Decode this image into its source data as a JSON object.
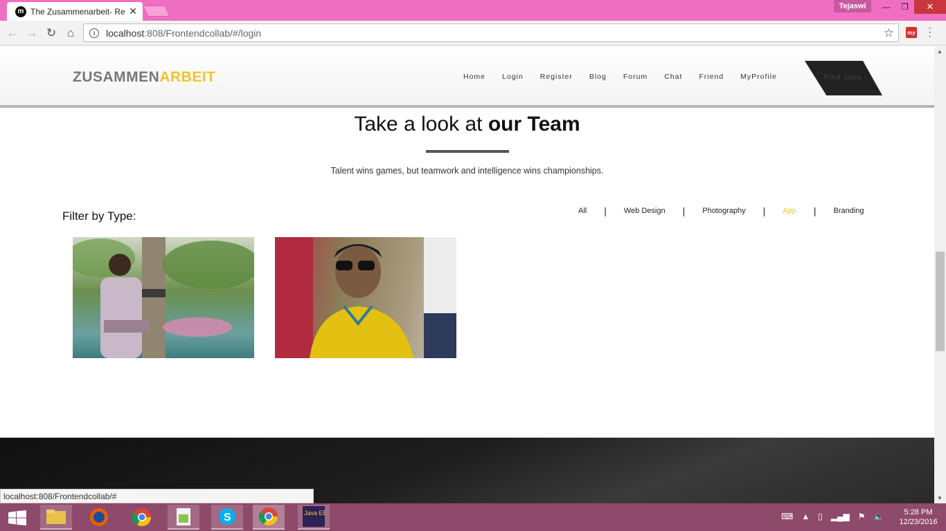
{
  "browser": {
    "tab_title": "The Zusammenarbeit- Re",
    "favicon_letter": "m",
    "user_name": "Tejaswi",
    "url_host": "localhost",
    "url_rest": ":808/Frontendcollab/#/login",
    "extension_label": "my"
  },
  "site": {
    "logo_part1": "ZUSAMMEN",
    "logo_part2": "ARBEIT",
    "nav": [
      "Home",
      "Login",
      "Register",
      "Blog",
      "Forum",
      "Chat",
      "Friend",
      "MyProfile"
    ],
    "find_jobs": "Find Jobs",
    "title_plain": "Take a look at ",
    "title_bold": "our Team",
    "tagline": "Talent wins games, but teamwork and intelligence wins championships.",
    "filter_label": "Filter by Type:",
    "filters": [
      "All",
      "Web Design",
      "Photography",
      "App",
      "Branding"
    ],
    "active_filter": "App",
    "status_url": "localhost:808/Frontendcollab/#"
  },
  "taskbar": {
    "apps": [
      "file-explorer",
      "firefox",
      "chrome",
      "notepad-plus-plus",
      "skype",
      "chrome-active",
      "java-ee-ide"
    ],
    "java_label": "Java EE IDE",
    "time": "5:28 PM",
    "date": "12/23/2016"
  },
  "colors": {
    "accent": "#f2c32b",
    "titlebar": "#f06ec2",
    "taskbar": "#8e4a6b"
  }
}
